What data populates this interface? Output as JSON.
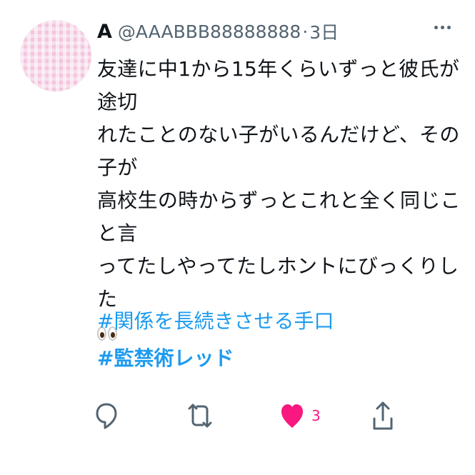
{
  "tweet": {
    "display_name": "A",
    "handle": "@AAABBB88888888",
    "separator": "·",
    "time": "3日",
    "text_lines": [
      "友達に中1から15年くらいずっと彼氏が途切",
      "れたことのない子がいるんだけど、その子が",
      "高校生の時からずっとこれと全く同じこと言",
      "ってたしやってたしホントにびっくりした"
    ],
    "emoji": "eyes",
    "hashtags": [
      "#関係を長続きさせる手口",
      "#監禁術レッド"
    ],
    "like_count": "3"
  },
  "icons": {
    "more": "more-icon",
    "reply": "reply-icon",
    "retweet": "retweet-icon",
    "like": "heart-icon",
    "share": "share-icon"
  },
  "colors": {
    "text": "#0f1419",
    "secondary": "#536471",
    "link": "#1d9bf0",
    "like": "#f91880",
    "avatar": "#f7dcec"
  }
}
